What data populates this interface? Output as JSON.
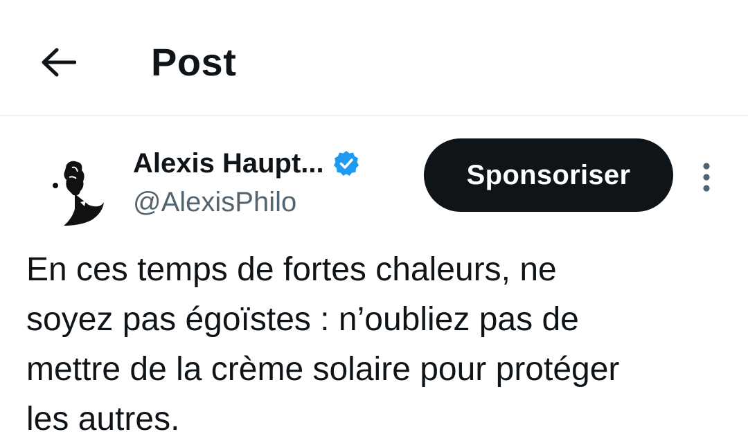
{
  "header": {
    "back_icon": "arrow-left-icon",
    "title": "Post"
  },
  "post": {
    "author": {
      "display_name": "Alexis Haupt...",
      "handle": "@AlexisPhilo",
      "verified": true,
      "verified_icon": "verified-badge-icon",
      "verified_color": "#1d9bf0"
    },
    "sponsor_label": "Sponsoriser",
    "more_icon": "more-vertical-icon",
    "text": "En ces temps de fortes chaleurs, ne\nsoyez pas égoïstes : n’oubliez pas de\nmettre de la crème solaire pour protéger\nles autres."
  },
  "colors": {
    "text_primary": "#0f1419",
    "text_secondary": "#536471",
    "accent": "#1d9bf0",
    "divider": "#eff3f4"
  }
}
